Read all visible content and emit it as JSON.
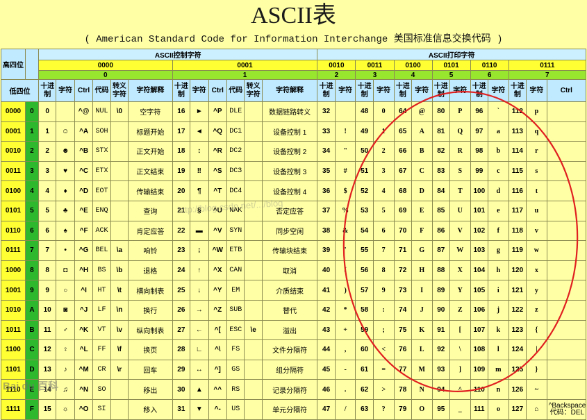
{
  "title": "ASCII表",
  "subtitle": "( American Standard Code for Information Interchange  美国标准信息交换代码 )",
  "header": {
    "corner_high": "高四位",
    "corner_low": "低四位",
    "ctrl_group": "ASCII控制字符",
    "print_group": "ASCII打印字符",
    "ctrl_bins": [
      "0000",
      "0001"
    ],
    "ctrl_hexes": [
      "0",
      "1"
    ],
    "print_bins": [
      "0010",
      "0011",
      "0100",
      "0101",
      "0110",
      "0111"
    ],
    "print_hexes": [
      "2",
      "3",
      "4",
      "5",
      "6",
      "7"
    ],
    "col_dec": "十进制",
    "col_char": "字符",
    "col_ctrl": "Ctrl",
    "col_code": "代码",
    "col_esc": "转义字符",
    "col_desc": "字符解释"
  },
  "rows": [
    {
      "bin": "0000",
      "hex": "0",
      "c0": {
        "dec": "0",
        "glyph": "",
        "ctrl": "^@",
        "abbr": "NUL",
        "esc": "\\0",
        "desc": "空字符"
      },
      "c1": {
        "dec": "16",
        "glyph": "►",
        "ctrl": "^P",
        "abbr": "DLE",
        "esc": "",
        "desc": "数据链路转义"
      },
      "p": [
        [
          "32",
          ""
        ],
        [
          "48",
          "0"
        ],
        [
          "64",
          "@"
        ],
        [
          "80",
          "P"
        ],
        [
          "96",
          "`"
        ],
        [
          "112",
          "p"
        ]
      ]
    },
    {
      "bin": "0001",
      "hex": "1",
      "c0": {
        "dec": "1",
        "glyph": "☺",
        "ctrl": "^A",
        "abbr": "SOH",
        "esc": "",
        "desc": "标题开始"
      },
      "c1": {
        "dec": "17",
        "glyph": "◄",
        "ctrl": "^Q",
        "abbr": "DC1",
        "esc": "",
        "desc": "设备控制 1"
      },
      "p": [
        [
          "33",
          "!"
        ],
        [
          "49",
          "1"
        ],
        [
          "65",
          "A"
        ],
        [
          "81",
          "Q"
        ],
        [
          "97",
          "a"
        ],
        [
          "113",
          "q"
        ]
      ]
    },
    {
      "bin": "0010",
      "hex": "2",
      "c0": {
        "dec": "2",
        "glyph": "☻",
        "ctrl": "^B",
        "abbr": "STX",
        "esc": "",
        "desc": "正文开始"
      },
      "c1": {
        "dec": "18",
        "glyph": "↕",
        "ctrl": "^R",
        "abbr": "DC2",
        "esc": "",
        "desc": "设备控制 2"
      },
      "p": [
        [
          "34",
          "\""
        ],
        [
          "50",
          "2"
        ],
        [
          "66",
          "B"
        ],
        [
          "82",
          "R"
        ],
        [
          "98",
          "b"
        ],
        [
          "114",
          "r"
        ]
      ]
    },
    {
      "bin": "0011",
      "hex": "3",
      "c0": {
        "dec": "3",
        "glyph": "♥",
        "ctrl": "^C",
        "abbr": "ETX",
        "esc": "",
        "desc": "正文结束"
      },
      "c1": {
        "dec": "19",
        "glyph": "‼",
        "ctrl": "^S",
        "abbr": "DC3",
        "esc": "",
        "desc": "设备控制 3"
      },
      "p": [
        [
          "35",
          "#"
        ],
        [
          "51",
          "3"
        ],
        [
          "67",
          "C"
        ],
        [
          "83",
          "S"
        ],
        [
          "99",
          "c"
        ],
        [
          "115",
          "s"
        ]
      ]
    },
    {
      "bin": "0100",
      "hex": "4",
      "c0": {
        "dec": "4",
        "glyph": "♦",
        "ctrl": "^D",
        "abbr": "EOT",
        "esc": "",
        "desc": "传输结束"
      },
      "c1": {
        "dec": "20",
        "glyph": "¶",
        "ctrl": "^T",
        "abbr": "DC4",
        "esc": "",
        "desc": "设备控制 4"
      },
      "p": [
        [
          "36",
          "$"
        ],
        [
          "52",
          "4"
        ],
        [
          "68",
          "D"
        ],
        [
          "84",
          "T"
        ],
        [
          "100",
          "d"
        ],
        [
          "116",
          "t"
        ]
      ]
    },
    {
      "bin": "0101",
      "hex": "5",
      "c0": {
        "dec": "5",
        "glyph": "♣",
        "ctrl": "^E",
        "abbr": "ENQ",
        "esc": "",
        "desc": "查询"
      },
      "c1": {
        "dec": "21",
        "glyph": "§",
        "ctrl": "^U",
        "abbr": "NAK",
        "esc": "",
        "desc": "否定应答"
      },
      "p": [
        [
          "37",
          "%"
        ],
        [
          "53",
          "5"
        ],
        [
          "69",
          "E"
        ],
        [
          "85",
          "U"
        ],
        [
          "101",
          "e"
        ],
        [
          "117",
          "u"
        ]
      ]
    },
    {
      "bin": "0110",
      "hex": "6",
      "c0": {
        "dec": "6",
        "glyph": "♠",
        "ctrl": "^F",
        "abbr": "ACK",
        "esc": "",
        "desc": "肯定应答"
      },
      "c1": {
        "dec": "22",
        "glyph": "▬",
        "ctrl": "^V",
        "abbr": "SYN",
        "esc": "",
        "desc": "同步空闲"
      },
      "p": [
        [
          "38",
          "&"
        ],
        [
          "54",
          "6"
        ],
        [
          "70",
          "F"
        ],
        [
          "86",
          "V"
        ],
        [
          "102",
          "f"
        ],
        [
          "118",
          "v"
        ]
      ]
    },
    {
      "bin": "0111",
      "hex": "7",
      "c0": {
        "dec": "7",
        "glyph": "•",
        "ctrl": "^G",
        "abbr": "BEL",
        "esc": "\\a",
        "desc": "响铃"
      },
      "c1": {
        "dec": "23",
        "glyph": "↨",
        "ctrl": "^W",
        "abbr": "ETB",
        "esc": "",
        "desc": "传输块结束"
      },
      "p": [
        [
          "39",
          "'"
        ],
        [
          "55",
          "7"
        ],
        [
          "71",
          "G"
        ],
        [
          "87",
          "W"
        ],
        [
          "103",
          "g"
        ],
        [
          "119",
          "w"
        ]
      ]
    },
    {
      "bin": "1000",
      "hex": "8",
      "c0": {
        "dec": "8",
        "glyph": "◘",
        "ctrl": "^H",
        "abbr": "BS",
        "esc": "\\b",
        "desc": "退格"
      },
      "c1": {
        "dec": "24",
        "glyph": "↑",
        "ctrl": "^X",
        "abbr": "CAN",
        "esc": "",
        "desc": "取消"
      },
      "p": [
        [
          "40",
          "("
        ],
        [
          "56",
          "8"
        ],
        [
          "72",
          "H"
        ],
        [
          "88",
          "X"
        ],
        [
          "104",
          "h"
        ],
        [
          "120",
          "x"
        ]
      ]
    },
    {
      "bin": "1001",
      "hex": "9",
      "c0": {
        "dec": "9",
        "glyph": "○",
        "ctrl": "^I",
        "abbr": "HT",
        "esc": "\\t",
        "desc": "横向制表"
      },
      "c1": {
        "dec": "25",
        "glyph": "↓",
        "ctrl": "^Y",
        "abbr": "EM",
        "esc": "",
        "desc": "介质结束"
      },
      "p": [
        [
          "41",
          ")"
        ],
        [
          "57",
          "9"
        ],
        [
          "73",
          "I"
        ],
        [
          "89",
          "Y"
        ],
        [
          "105",
          "i"
        ],
        [
          "121",
          "y"
        ]
      ]
    },
    {
      "bin": "1010",
      "hex": "A",
      "c0": {
        "dec": "10",
        "glyph": "◙",
        "ctrl": "^J",
        "abbr": "LF",
        "esc": "\\n",
        "desc": "换行"
      },
      "c1": {
        "dec": "26",
        "glyph": "→",
        "ctrl": "^Z",
        "abbr": "SUB",
        "esc": "",
        "desc": "替代"
      },
      "p": [
        [
          "42",
          "*"
        ],
        [
          "58",
          ":"
        ],
        [
          "74",
          "J"
        ],
        [
          "90",
          "Z"
        ],
        [
          "106",
          "j"
        ],
        [
          "122",
          "z"
        ]
      ]
    },
    {
      "bin": "1011",
      "hex": "B",
      "c0": {
        "dec": "11",
        "glyph": "♂",
        "ctrl": "^K",
        "abbr": "VT",
        "esc": "\\v",
        "desc": "纵向制表"
      },
      "c1": {
        "dec": "27",
        "glyph": "←",
        "ctrl": "^[",
        "abbr": "ESC",
        "esc": "\\e",
        "desc": "溢出"
      },
      "p": [
        [
          "43",
          "+"
        ],
        [
          "59",
          ";"
        ],
        [
          "75",
          "K"
        ],
        [
          "91",
          "["
        ],
        [
          "107",
          "k"
        ],
        [
          "123",
          "{"
        ]
      ]
    },
    {
      "bin": "1100",
      "hex": "C",
      "c0": {
        "dec": "12",
        "glyph": "♀",
        "ctrl": "^L",
        "abbr": "FF",
        "esc": "\\f",
        "desc": "换页"
      },
      "c1": {
        "dec": "28",
        "glyph": "∟",
        "ctrl": "^\\",
        "abbr": "FS",
        "esc": "",
        "desc": "文件分隔符"
      },
      "p": [
        [
          "44",
          ","
        ],
        [
          "60",
          "<"
        ],
        [
          "76",
          "L"
        ],
        [
          "92",
          "\\"
        ],
        [
          "108",
          "l"
        ],
        [
          "124",
          "|"
        ]
      ]
    },
    {
      "bin": "1101",
      "hex": "D",
      "c0": {
        "dec": "13",
        "glyph": "♪",
        "ctrl": "^M",
        "abbr": "CR",
        "esc": "\\r",
        "desc": "回车"
      },
      "c1": {
        "dec": "29",
        "glyph": "↔",
        "ctrl": "^]",
        "abbr": "GS",
        "esc": "",
        "desc": "组分隔符"
      },
      "p": [
        [
          "45",
          "-"
        ],
        [
          "61",
          "="
        ],
        [
          "77",
          "M"
        ],
        [
          "93",
          "]"
        ],
        [
          "109",
          "m"
        ],
        [
          "125",
          "}"
        ]
      ]
    },
    {
      "bin": "1110",
      "hex": "E",
      "c0": {
        "dec": "14",
        "glyph": "♫",
        "ctrl": "^N",
        "abbr": "SO",
        "esc": "",
        "desc": "移出"
      },
      "c1": {
        "dec": "30",
        "glyph": "▲",
        "ctrl": "^^",
        "abbr": "RS",
        "esc": "",
        "desc": "记录分隔符"
      },
      "p": [
        [
          "46",
          "."
        ],
        [
          "62",
          ">"
        ],
        [
          "78",
          "N"
        ],
        [
          "94",
          "^"
        ],
        [
          "110",
          "n"
        ],
        [
          "126",
          "~"
        ]
      ]
    },
    {
      "bin": "1111",
      "hex": "F",
      "c0": {
        "dec": "15",
        "glyph": "☼",
        "ctrl": "^O",
        "abbr": "SI",
        "esc": "",
        "desc": "移入"
      },
      "c1": {
        "dec": "31",
        "glyph": "▼",
        "ctrl": "^-",
        "abbr": "US",
        "esc": "",
        "desc": "单元分隔符"
      },
      "p": [
        [
          "47",
          "/"
        ],
        [
          "63",
          "?"
        ],
        [
          "79",
          "O"
        ],
        [
          "95",
          "_"
        ],
        [
          "111",
          "o"
        ],
        [
          "127",
          "⌂"
        ]
      ]
    }
  ],
  "del_note": "^Backspace 代码：DEL",
  "watermark": "http://blog.csdn.net/.../blog",
  "logo_text": "Bai du 百科",
  "colors": {
    "circle": "#e02020",
    "hex_cell": "#2eb82e",
    "band": "#ffff33"
  }
}
